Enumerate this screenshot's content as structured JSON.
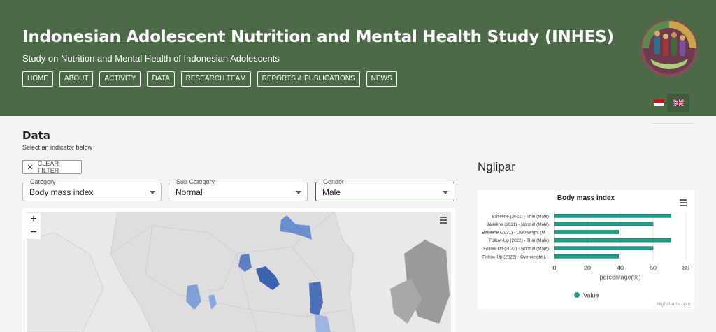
{
  "header": {
    "title": "Indonesian Adolescent Nutrition and Mental Health Study (INHES)",
    "subtitle": "Study on Nutrition and Mental Health of Indonesian Adolescents",
    "nav": [
      "HOME",
      "ABOUT",
      "ACTIVITY",
      "DATA",
      "RESEARCH TEAM",
      "REPORTS & PUBLICATIONS",
      "NEWS"
    ],
    "languages": [
      "id-flag-icon",
      "uk-flag-icon"
    ],
    "colors": {
      "header_bg": "#4a6b45",
      "accent": "#1f9e89"
    }
  },
  "data_section": {
    "title": "Data",
    "subtitle": "Select an indicator below",
    "clear_filter": "CLEAR FILTER",
    "filters": {
      "category": {
        "label": "Category",
        "value": "Body mass index"
      },
      "sub_category": {
        "label": "Sub Category",
        "value": "Normal"
      },
      "gender": {
        "label": "Gender",
        "value": "Male"
      }
    }
  },
  "map": {
    "zoom_in": "+",
    "zoom_out": "−"
  },
  "detail": {
    "region_name": "Nglipar",
    "credits": "Highcharts.com"
  },
  "chart_data": {
    "type": "bar",
    "title": "Body mass index",
    "categories": [
      "Baseline (2021) - Thin (Male)",
      "Baseline (2021) - Normal (Male)",
      "Baseline (2021) - Overweight (M...",
      "Follow-Up (2022) - Thin (Male)",
      "Follow-Up (2022) - Normal (Male)",
      "Follow-Up (2022) - Overweight (..."
    ],
    "series": [
      {
        "name": "Value",
        "values": [
          71,
          60,
          39,
          71,
          60,
          39
        ]
      }
    ],
    "xlabel": "percentage(%)",
    "xlim": [
      0,
      80
    ],
    "ticks": [
      0,
      20,
      40,
      60,
      80
    ],
    "orientation": "horizontal",
    "legend": "bottom-center",
    "color": "#1f9e89"
  }
}
